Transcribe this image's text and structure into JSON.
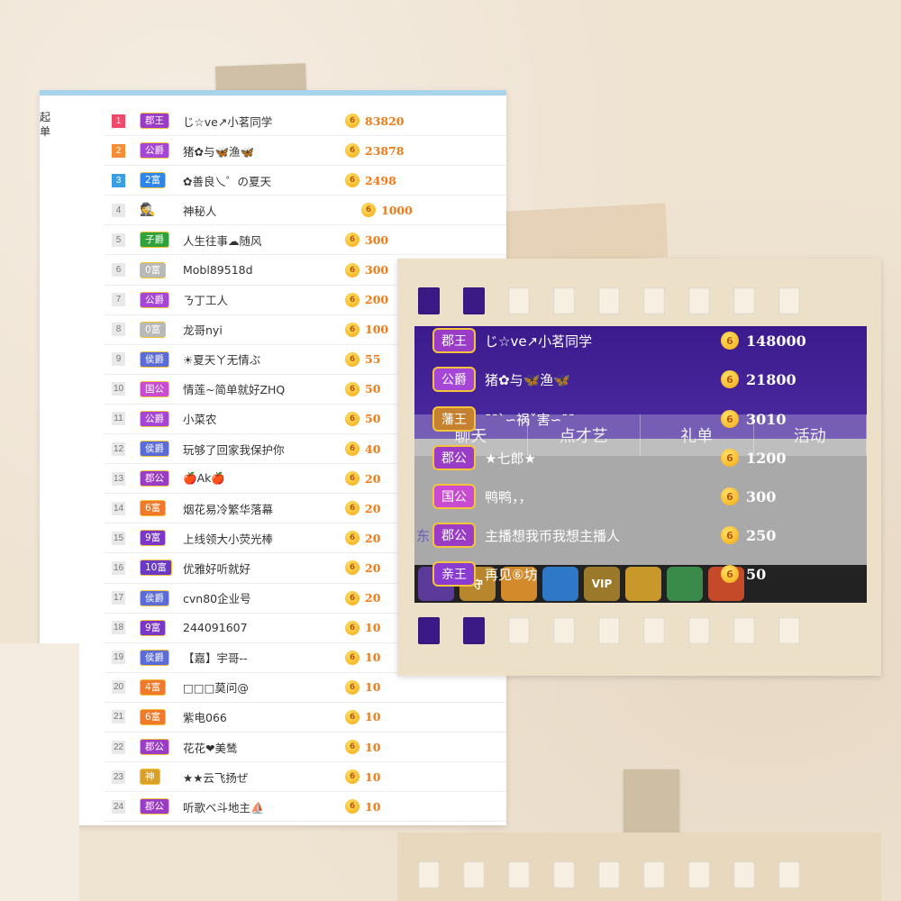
{
  "board": {
    "side_label": "起单",
    "rows": [
      {
        "rank": "1",
        "badge": "郡王",
        "badge_color": "#9b3cc7",
        "name": "じ☆ve↗小茗同学",
        "amount": "83820"
      },
      {
        "rank": "2",
        "badge": "公爵",
        "badge_color": "#a646d6",
        "name": "猪✿与🦋渔🦋",
        "amount": "23878"
      },
      {
        "rank": "3",
        "badge": "2富",
        "badge_color": "#2f86e8",
        "name": "✿善良乀゜の夏天",
        "amount": "2498"
      },
      {
        "rank": "4",
        "badge": "",
        "badge_color": "",
        "name": "神秘人",
        "amount": "1000"
      },
      {
        "rank": "5",
        "badge": "子爵",
        "badge_color": "#2fa23a",
        "name": "人生往事☁随风",
        "amount": "300"
      },
      {
        "rank": "6",
        "badge": "0富",
        "badge_color": "#b9b9b9",
        "name": "Mobl89518d",
        "amount": "300"
      },
      {
        "rank": "7",
        "badge": "公爵",
        "badge_color": "#a646d6",
        "name": "ㄋ丁工人",
        "amount": "200"
      },
      {
        "rank": "8",
        "badge": "0富",
        "badge_color": "#b9b9b9",
        "name": "龙哥nyi",
        "amount": "100"
      },
      {
        "rank": "9",
        "badge": "侯爵",
        "badge_color": "#5b6bd8",
        "name": "☀夏天ㄚ无情ぶ",
        "amount": "55"
      },
      {
        "rank": "10",
        "badge": "国公",
        "badge_color": "#c94bd2",
        "name": "情莲~简单就好ZHQ",
        "amount": "50"
      },
      {
        "rank": "11",
        "badge": "公爵",
        "badge_color": "#a646d6",
        "name": "小菜农",
        "amount": "50"
      },
      {
        "rank": "12",
        "badge": "侯爵",
        "badge_color": "#5b6bd8",
        "name": "玩够了回家我保护你",
        "amount": "40"
      },
      {
        "rank": "13",
        "badge": "郡公",
        "badge_color": "#9b3cc7",
        "name": "🍎Ak🍎",
        "amount": "20"
      },
      {
        "rank": "14",
        "badge": "6富",
        "badge_color": "#f07a2a",
        "name": "烟花易冷繁华落幕",
        "amount": "20"
      },
      {
        "rank": "15",
        "badge": "9富",
        "badge_color": "#7b37c8",
        "name": "上线领大小荧光棒",
        "amount": "20"
      },
      {
        "rank": "16",
        "badge": "10富",
        "badge_color": "#6a3ac6",
        "name": "优雅好听就好",
        "amount": "20"
      },
      {
        "rank": "17",
        "badge": "侯爵",
        "badge_color": "#5b6bd8",
        "name": "cvn80企业号",
        "amount": "20"
      },
      {
        "rank": "18",
        "badge": "9富",
        "badge_color": "#7b37c8",
        "name": "244091607",
        "amount": "10"
      },
      {
        "rank": "19",
        "badge": "侯爵",
        "badge_color": "#5b6bd8",
        "name": "【嘉】宇哥--",
        "amount": "10"
      },
      {
        "rank": "20",
        "badge": "4富",
        "badge_color": "#f07a2a",
        "name": "□□□莫问@",
        "amount": "10"
      },
      {
        "rank": "21",
        "badge": "6富",
        "badge_color": "#f07a2a",
        "name": "紫电066",
        "amount": "10"
      },
      {
        "rank": "22",
        "badge": "郡公",
        "badge_color": "#9b3cc7",
        "name": "花花❤美鸶",
        "amount": "10"
      },
      {
        "rank": "23",
        "badge": "神",
        "badge_color": "#d9a02a",
        "name": "★★云飞扬ぜ",
        "amount": "10"
      },
      {
        "rank": "24",
        "badge": "郡公",
        "badge_color": "#9b3cc7",
        "name": "听歌べ斗地主⛵",
        "amount": "10"
      }
    ]
  },
  "film": {
    "tabs": [
      "聊天",
      "点才艺",
      "礼单",
      "活动"
    ],
    "left_label": "东",
    "rows": [
      {
        "badge": "郡王",
        "badge_color": "#9b3cc7",
        "name": "じ☆ve↗小茗同学",
        "amount": "148000"
      },
      {
        "badge": "公爵",
        "badge_color": "#a646d6",
        "name": "猪✿与🦋渔🦋",
        "amount": "21800"
      },
      {
        "badge": "藩王",
        "badge_color": "#c58030",
        "name": "ˉˉˋ∽祸ˇ害∽ˉˉ",
        "amount": "3010"
      },
      {
        "badge": "郡公",
        "badge_color": "#9b3cc7",
        "name": "★七郎★",
        "amount": "1200"
      },
      {
        "badge": "国公",
        "badge_color": "#c94bd2",
        "name": "鸭鸭，，",
        "amount": "300"
      },
      {
        "badge": "郡公",
        "badge_color": "#9b3cc7",
        "name": "主播想我币我想主播人",
        "amount": "250"
      },
      {
        "badge": "亲王",
        "badge_color": "#8b3cd0",
        "name": "再见⑥坊",
        "amount": "50"
      }
    ],
    "gifts": [
      {
        "label": "",
        "color": "#5b3a9a"
      },
      {
        "label": "守",
        "color": "#b8862c"
      },
      {
        "label": "",
        "color": "#d38a2a"
      },
      {
        "label": "",
        "color": "#2f78c8"
      },
      {
        "label": "VIP",
        "color": "#9a7a2a"
      },
      {
        "label": "",
        "color": "#c8982a"
      },
      {
        "label": "",
        "color": "#3a8a4a"
      },
      {
        "label": "",
        "color": "#c54a2a"
      }
    ]
  },
  "coin_glyph": "6"
}
